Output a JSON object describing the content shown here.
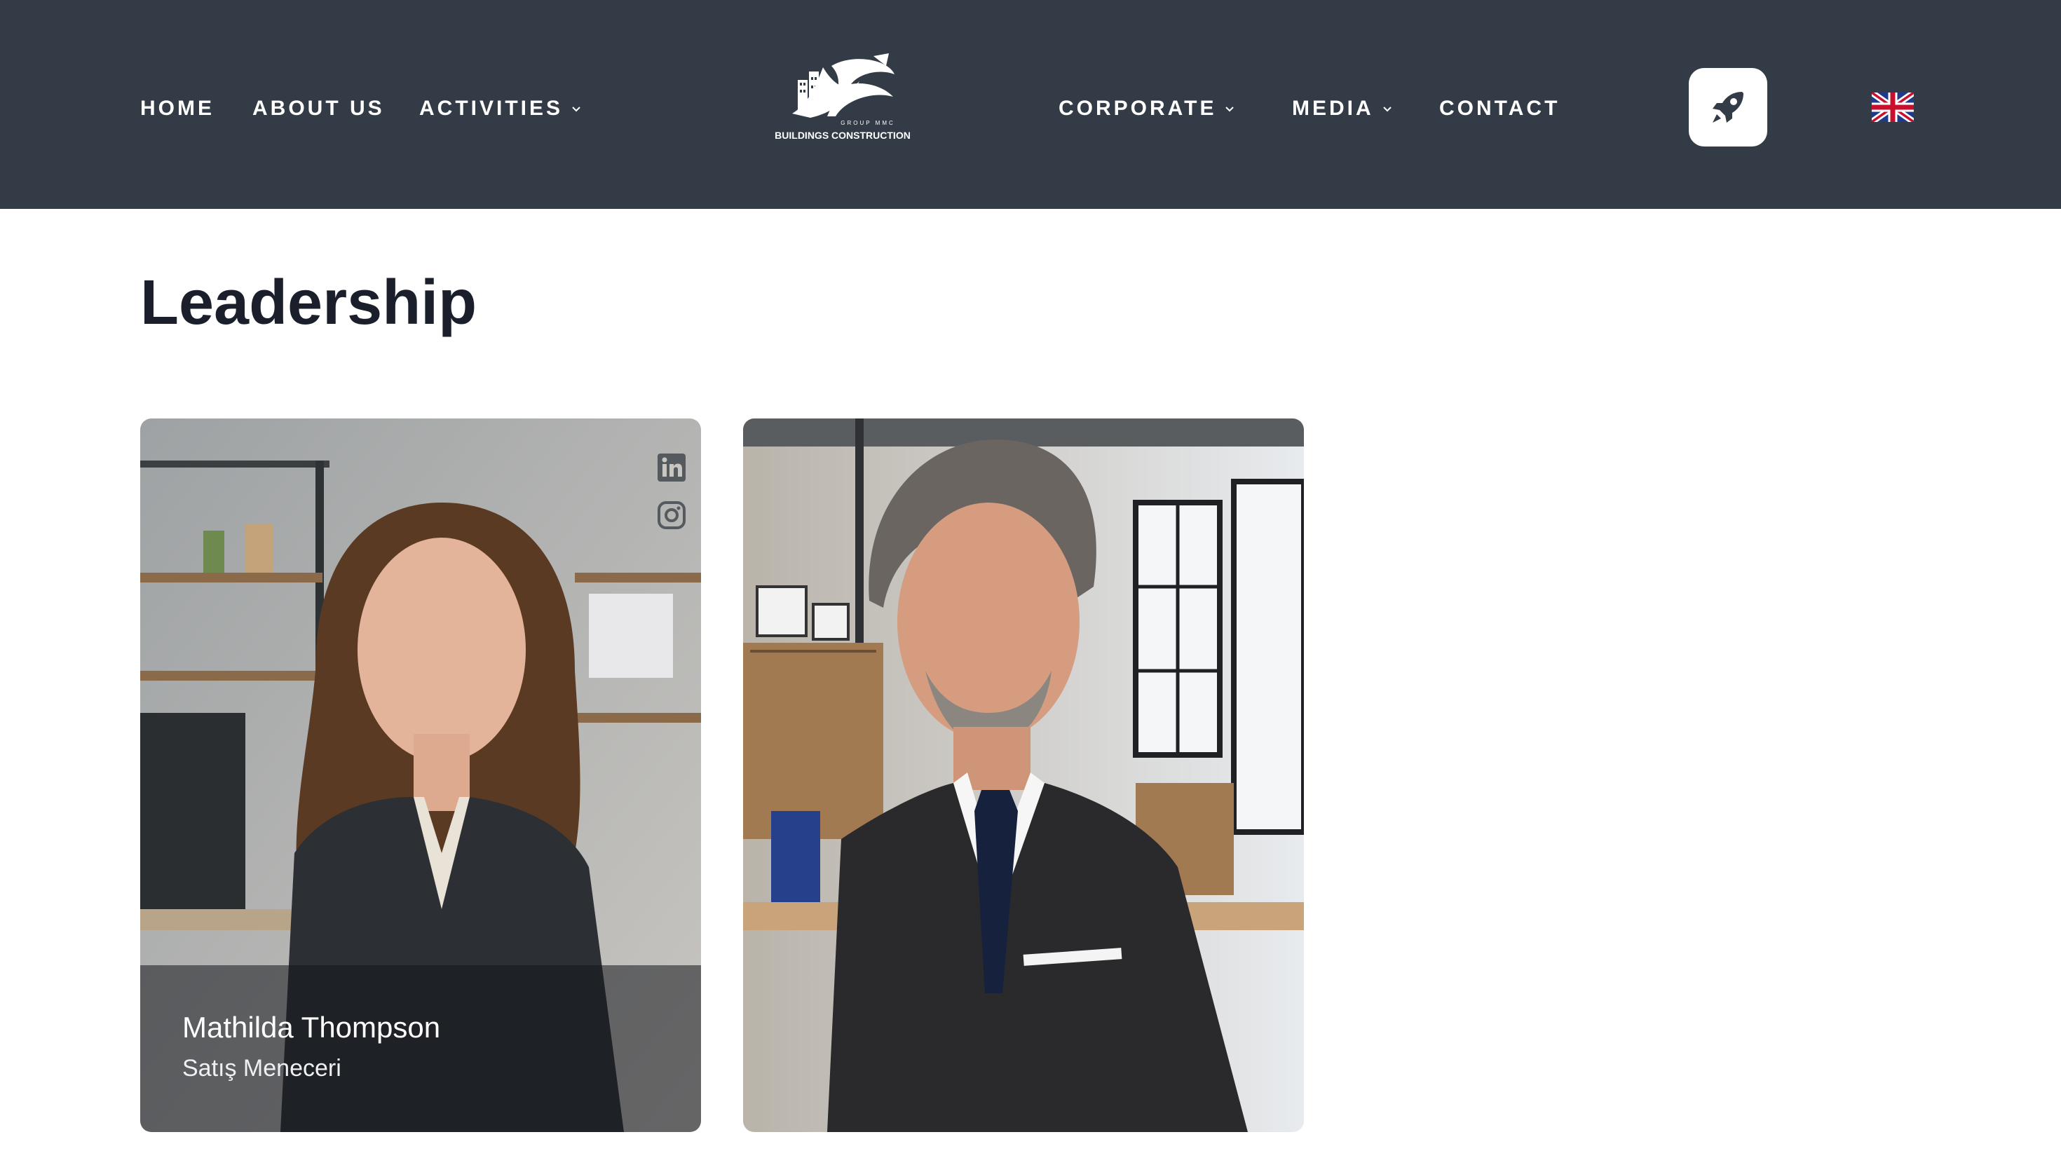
{
  "nav": {
    "left": [
      {
        "label": "HOME"
      },
      {
        "label": "ABOUT US"
      },
      {
        "label": "ACTIVITIES",
        "dropdown": true
      }
    ],
    "right": [
      {
        "label": "CORPORATE",
        "dropdown": true
      },
      {
        "label": "MEDIA",
        "dropdown": true
      },
      {
        "label": "CONTACT"
      }
    ]
  },
  "logo": {
    "small_text": "GROUP MMC",
    "subtitle": "BUILDINGS CONSTRUCTION"
  },
  "icons": {
    "launch": "rocket-icon",
    "language": "uk-flag-icon",
    "social": [
      "linkedin-icon",
      "instagram-icon"
    ]
  },
  "colors": {
    "header_bg": "#333b46",
    "title": "#1a1f2b"
  },
  "page": {
    "title": "Leadership"
  },
  "team": [
    {
      "name": "Mathilda Thompson",
      "role": "Satış Meneceri"
    },
    {}
  ]
}
